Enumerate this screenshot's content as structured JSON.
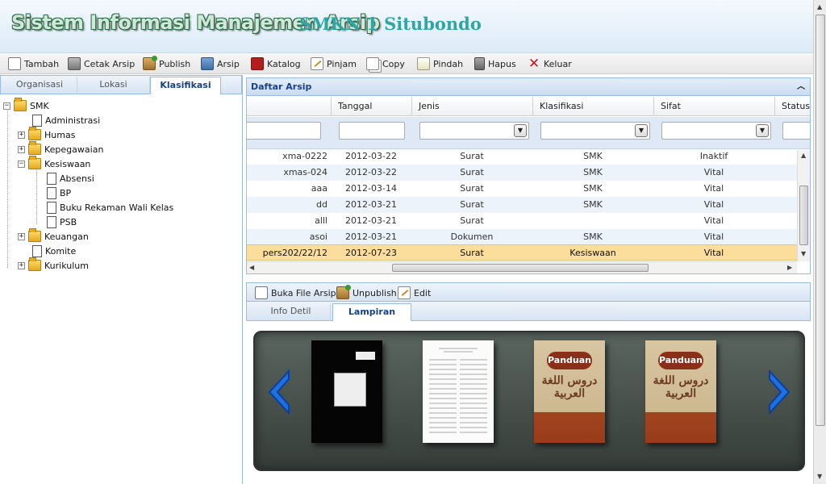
{
  "header": {
    "app_title": "Sistem Informasi Manajemen Arsip",
    "school": "SMKN 1 Situbondo"
  },
  "toolbar": [
    {
      "label": "Tambah",
      "icon": "new-document-icon"
    },
    {
      "label": "Cetak Arsip",
      "icon": "printer-icon"
    },
    {
      "label": "Publish",
      "icon": "publish-box-icon"
    },
    {
      "label": "Arsip",
      "icon": "archive-icon"
    },
    {
      "label": "Katalog",
      "icon": "pdf-icon"
    },
    {
      "label": "Pinjam",
      "icon": "pen-icon"
    },
    {
      "label": "Copy",
      "icon": "copy-icon"
    },
    {
      "label": "Pindah",
      "icon": "move-icon"
    },
    {
      "label": "Hapus",
      "icon": "trash-icon"
    },
    {
      "label": "Keluar",
      "icon": "close-icon"
    }
  ],
  "left_tabs": [
    "Organisasi",
    "Lokasi",
    "Klasifikasi"
  ],
  "tree": {
    "root": "SMK",
    "items": [
      "Administrasi",
      "Humas",
      "Kepegawaian",
      "Kesiswaan",
      "Absensi",
      "BP",
      "Buku Rekaman Wali Kelas",
      "PSB",
      "Keuangan",
      "Komite",
      "Kurikulum"
    ]
  },
  "grid": {
    "title": "Daftar Arsip",
    "columns": [
      "Tanggal",
      "Jenis",
      "Klasifikasi",
      "Sifat",
      "Status"
    ],
    "rows": [
      {
        "kode": "xma-0222",
        "tanggal": "2012-03-22",
        "jenis": "Surat",
        "klasifikasi": "SMK",
        "sifat": "Inaktif"
      },
      {
        "kode": "xmas-024",
        "tanggal": "2012-03-22",
        "jenis": "Surat",
        "klasifikasi": "SMK",
        "sifat": "Vital"
      },
      {
        "kode": "aaa",
        "tanggal": "2012-03-14",
        "jenis": "Surat",
        "klasifikasi": "SMK",
        "sifat": "Vital"
      },
      {
        "kode": "dd",
        "tanggal": "2012-03-21",
        "jenis": "Surat",
        "klasifikasi": "SMK",
        "sifat": "Vital"
      },
      {
        "kode": "alll",
        "tanggal": "2012-03-21",
        "jenis": "Surat",
        "klasifikasi": "",
        "sifat": "Vital"
      },
      {
        "kode": "asoi",
        "tanggal": "2012-03-21",
        "jenis": "Dokumen",
        "klasifikasi": "SMK",
        "sifat": "Vital"
      },
      {
        "kode": "pers202/22/12",
        "tanggal": "2012-07-23",
        "jenis": "Surat",
        "klasifikasi": "Kesiswaan",
        "sifat": "Vital"
      }
    ],
    "selected_row": 6
  },
  "detail": {
    "toolbar": [
      "Buka File Arsip",
      "Unpublish",
      "Edit"
    ],
    "tabs": [
      "Info Detil",
      "Lampiran"
    ],
    "active_tab": "Lampiran",
    "book_label": "Panduan",
    "book_arabic": "دروس اللغة العربية"
  },
  "colors": {
    "accent": "#15428b",
    "selected_row": "#fbdd9c",
    "panel_border": "#99bbe8"
  }
}
